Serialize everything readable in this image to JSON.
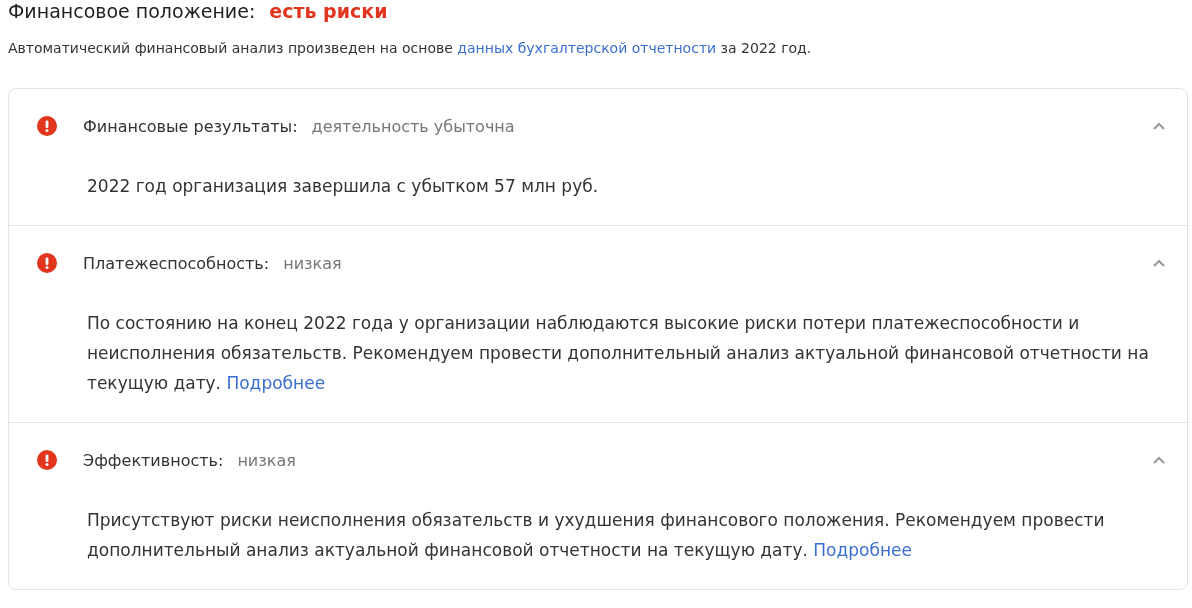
{
  "header": {
    "title": "Финансовое положение:",
    "status": "есть риски"
  },
  "intro": {
    "before": "Автоматический финансовый анализ произведен на основе ",
    "link": "данных бухгалтерской отчетности",
    "after": " за 2022 год."
  },
  "sections": [
    {
      "label": "Финансовые результаты:",
      "value": "деятельность убыточна",
      "expanded": true,
      "text": "2022 год организация завершила с убытком 57 млн руб."
    },
    {
      "label": "Платежеспособность:",
      "value": "низкая",
      "expanded": true,
      "text": "По состоянию на конец 2022 года у организации наблюдаются высокие риски потери платежеспособности и неисполнения обязательств. Рекомендуем провести дополнительный анализ актуальной финансовой отчетности на текущую дату.",
      "link": "Подробнее"
    },
    {
      "label": "Эффективность:",
      "value": "низкая",
      "expanded": true,
      "text": "Присутствуют риски неисполнения обязательств и ухудшения финансового положения. Рекомендуем провести дополнительный анализ актуальной финансовой отчетности на текущую дату.",
      "link": "Подробнее"
    }
  ]
}
